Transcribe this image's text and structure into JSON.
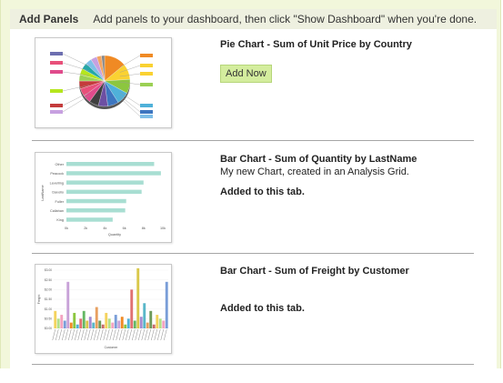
{
  "header": {
    "title": "Add Panels",
    "description": "Add panels to your dashboard, then click \"Show Dashboard\" when you're done."
  },
  "panels": [
    {
      "title_prefix": "Pie Chart - ",
      "title_main": "Sum of Unit Price by Country",
      "subtitle": "",
      "status": "",
      "button_label": "Add Now"
    },
    {
      "title_prefix": "Bar Chart - ",
      "title_main": "Sum of Quantity by LastName",
      "subtitle": "My new Chart, created in an Analysis Grid.",
      "status": "Added to this tab.",
      "button_label": ""
    },
    {
      "title_prefix": "Bar Chart - ",
      "title_main": "Sum of Freight by Customer",
      "subtitle": "",
      "status": "Added to this tab.",
      "button_label": ""
    }
  ],
  "chart_data": [
    {
      "type": "pie",
      "values": [
        14,
        10,
        9,
        8,
        7,
        6,
        6,
        5,
        5,
        5,
        4,
        4,
        4,
        4,
        4,
        3,
        2
      ],
      "colors": [
        "#f08a24",
        "#fad232",
        "#8cc63f",
        "#4fb1d9",
        "#3d76c0",
        "#6d4fa3",
        "#3f3f3f",
        "#e04b8b",
        "#e8507a",
        "#c43b3b",
        "#9bd054",
        "#b5e61d",
        "#25a8a8",
        "#7fbfe8",
        "#c7a0e0",
        "#f4a460",
        "#888888"
      ],
      "legend_left": [
        "",
        "",
        "",
        "",
        "",
        ""
      ],
      "legend_right": [
        "",
        "",
        "",
        "",
        "",
        "",
        ""
      ]
    },
    {
      "type": "bar",
      "orientation": "horizontal",
      "categories": [
        "Other",
        "Peacock",
        "Leverling",
        "Davolio",
        "Fuller",
        "Callahan",
        "King"
      ],
      "values": [
        9.1,
        9.8,
        8.0,
        7.8,
        6.2,
        6.1,
        4.8
      ],
      "xticks": [
        "0k",
        "2k",
        "4k",
        "6k",
        "8k",
        "10k"
      ],
      "xlim": [
        0,
        10
      ],
      "xlabel": "Quantity",
      "ylabel": "LastName",
      "color": "#a8ded2"
    },
    {
      "type": "bar",
      "categories": [],
      "values": [
        0.9,
        0.5,
        0.7,
        0.4,
        2.4,
        0.3,
        0.8,
        0.2,
        0.5,
        0.9,
        0.4,
        0.6,
        0.3,
        1.1,
        0.4,
        0.2,
        0.8,
        0.5,
        0.3,
        0.7,
        0.4,
        0.6,
        0.2,
        0.5,
        2.0,
        0.4,
        3.1,
        0.6,
        1.3,
        0.3,
        0.9,
        0.2,
        0.7,
        0.5,
        0.4,
        2.4
      ],
      "yticks": [
        "$0.00",
        "$0.50",
        "$1.00",
        "$1.50",
        "$2.00",
        "$2.50",
        "$3.00"
      ],
      "ylim": [
        0,
        3
      ],
      "xlabel": "Customer",
      "ylabel": "Freight",
      "colors": [
        "#f4d35e",
        "#b2e08a",
        "#f4a3c0",
        "#7a9ed8",
        "#c8a2d8",
        "#f08a24",
        "#8cc63f",
        "#4fb1d9",
        "#e07070",
        "#65b866",
        "#d9c84a",
        "#a38bd1",
        "#59b7c9",
        "#e8a060",
        "#6d9a5a",
        "#c96b6b"
      ]
    }
  ]
}
